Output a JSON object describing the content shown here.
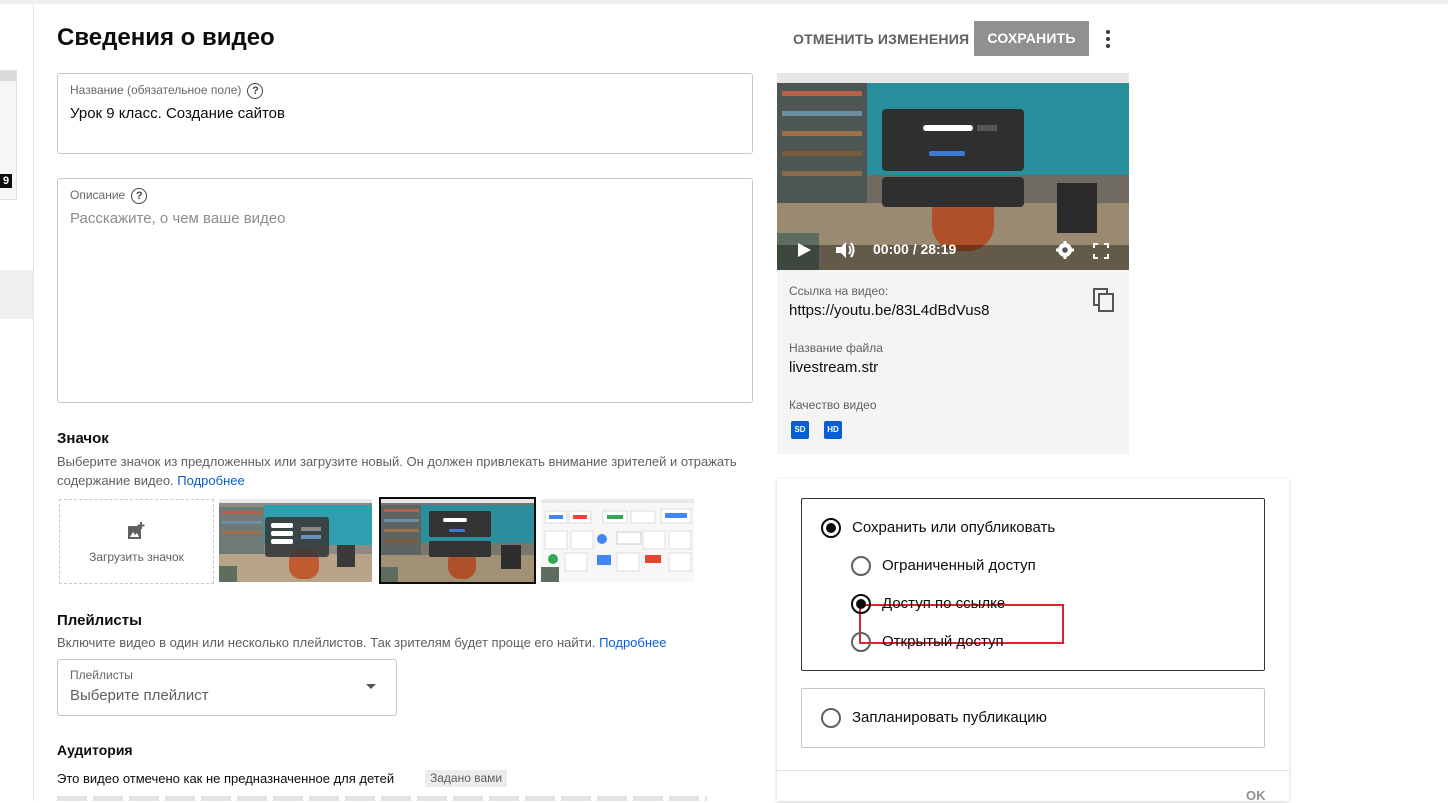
{
  "header": {
    "title": "Сведения о видео",
    "discard_label": "ОТМЕНИТЬ ИЗМЕНЕНИЯ",
    "save_label": "СОХРАНИТЬ",
    "more_icon": "more-vert-icon"
  },
  "left_rail": {
    "badge": "9"
  },
  "title_field": {
    "label": "Название (обязательное поле)",
    "help": "?",
    "value": "Урок 9 класс. Создание сайтов"
  },
  "description_field": {
    "label": "Описание",
    "help": "?",
    "placeholder": "Расскажите, о чем ваше видео"
  },
  "thumbnail": {
    "heading": "Значок",
    "text": "Выберите значок из предложенных или загрузите новый. Он должен привлекать внимание зрителей и отражать",
    "text2": "содержание видео.",
    "more_link": "Подробнее",
    "upload_label": "Загрузить значок",
    "upload_icon": "add-photo-icon",
    "selected_index": 1
  },
  "playlists": {
    "heading": "Плейлисты",
    "text": "Включите видео в один или несколько плейлистов. Так зрителям будет проще его найти.",
    "more_link": "Подробнее",
    "select_label": "Плейлисты",
    "select_value": "Выберите плейлист"
  },
  "audience": {
    "heading": "Аудитория",
    "line": "Это видео отмечено как не предназначенное для детей",
    "chip": "Задано вами"
  },
  "player": {
    "time": "00:00 / 28:19",
    "icons": [
      "play-icon",
      "volume-icon",
      "settings-gear-icon",
      "fullscreen-icon"
    ]
  },
  "info": {
    "link_label": "Ссылка на видео:",
    "link_value": "https://youtu.be/83L4dBdVus8",
    "filename_label": "Название файла",
    "filename_value": "livestream.str",
    "quality_label": "Качество видео",
    "quality_badges": [
      "SD",
      "HD"
    ],
    "copy_icon": "copy-icon"
  },
  "visibility": {
    "save_publish_label": "Сохранить или опубликовать",
    "options": [
      "Ограниченный доступ",
      "Доступ по ссылке",
      "Открытый доступ"
    ],
    "selected_option": "Доступ по ссылке",
    "schedule_label": "Запланировать публикацию",
    "ok_label": "OK",
    "highlight_color": "#e0242c"
  },
  "colors": {
    "link": "#065fd4",
    "save_button_bg": "#909090"
  }
}
